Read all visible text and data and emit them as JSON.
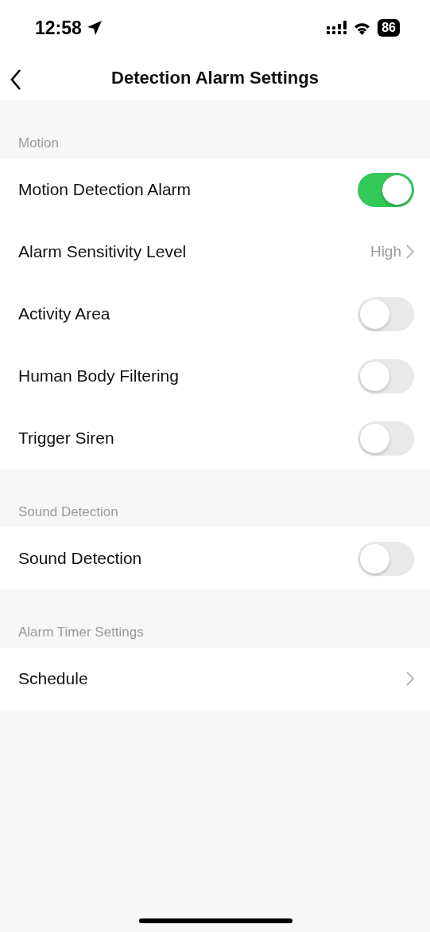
{
  "status_bar": {
    "time": "12:58",
    "battery": "86"
  },
  "header": {
    "title": "Detection Alarm Settings"
  },
  "sections": [
    {
      "title": "Motion",
      "rows": [
        {
          "kind": "toggle",
          "label": "Motion Detection Alarm",
          "on": true
        },
        {
          "kind": "link",
          "label": "Alarm Sensitivity Level",
          "value": "High"
        },
        {
          "kind": "toggle",
          "label": "Activity Area",
          "on": false
        },
        {
          "kind": "toggle",
          "label": "Human Body Filtering",
          "on": false
        },
        {
          "kind": "toggle",
          "label": "Trigger Siren",
          "on": false
        }
      ]
    },
    {
      "title": "Sound Detection",
      "rows": [
        {
          "kind": "toggle",
          "label": "Sound Detection",
          "on": false
        }
      ]
    },
    {
      "title": "Alarm Timer Settings",
      "rows": [
        {
          "kind": "link",
          "label": "Schedule"
        }
      ]
    }
  ]
}
